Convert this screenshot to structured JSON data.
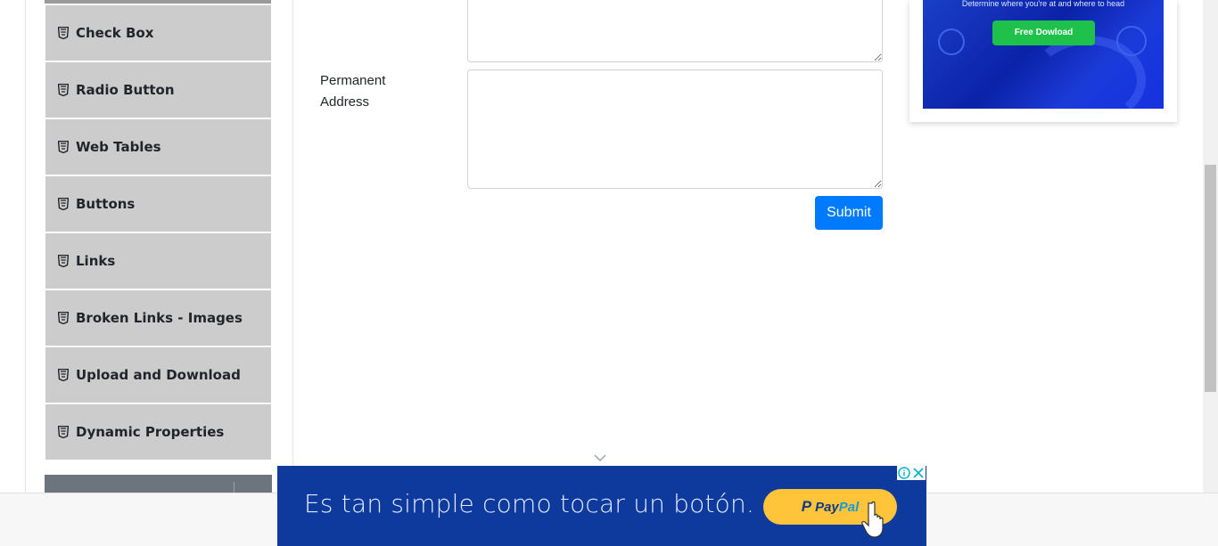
{
  "sidebar": {
    "items": [
      {
        "label": "Check Box",
        "icon": "html5-icon"
      },
      {
        "label": "Radio Button",
        "icon": "html5-icon"
      },
      {
        "label": "Web Tables",
        "icon": "html5-icon"
      },
      {
        "label": "Buttons",
        "icon": "html5-icon"
      },
      {
        "label": "Links",
        "icon": "html5-icon"
      },
      {
        "label": "Broken Links - Images",
        "icon": "html5-icon"
      },
      {
        "label": "Upload and Download",
        "icon": "html5-icon"
      },
      {
        "label": "Dynamic Properties",
        "icon": "html5-icon"
      }
    ]
  },
  "form": {
    "permanent_address_label_line1": "Permanent",
    "permanent_address_label_line2": "Address",
    "current_address_value": "",
    "permanent_address_value": "",
    "submit_label": "Submit"
  },
  "side_ad": {
    "subtitle": "Determine where you're at and where to head",
    "button_label": "Free Dowload"
  },
  "bottom_ad": {
    "headline": "Es tan simple como tocar un botón.",
    "brand_pay": "Pay",
    "brand_pal": "Pal",
    "brand_p": "P"
  },
  "colors": {
    "submit": "#007bff",
    "menu_item_bg": "#cccccc",
    "group_header_bg": "#6c757d",
    "paypal_yellow": "#ffc439",
    "ad_blue": "#0d3a9c"
  }
}
